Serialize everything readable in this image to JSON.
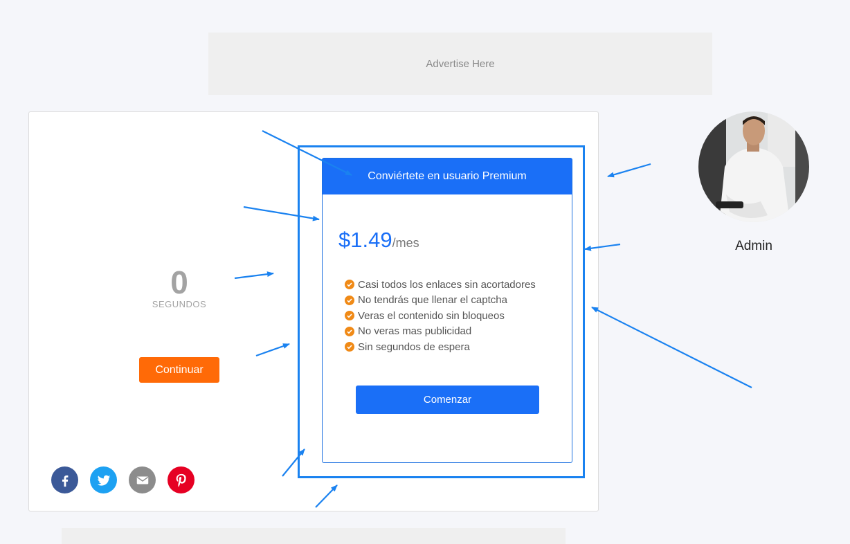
{
  "ad_top": {
    "text": "Advertise Here"
  },
  "countdown": {
    "value": "0",
    "label": "SEGUNDOS"
  },
  "continue_button": "Continuar",
  "share": {
    "icons": [
      "facebook-icon",
      "twitter-icon",
      "email-icon",
      "pinterest-icon"
    ],
    "colors": [
      "#3b5998",
      "#1da1f2",
      "#8c8c8c",
      "#e60023"
    ]
  },
  "premium": {
    "title": "Conviértete en usuario Premium",
    "price": "$1.49",
    "period": "/mes",
    "features": [
      "Casi todos los enlaces sin acortadores",
      "No tendrás que llenar el captcha",
      "Veras el contenido sin bloqueos",
      "No veras mas publicidad",
      "Sin segundos de espera"
    ],
    "button": "Comenzar"
  },
  "profile": {
    "name": "Admin"
  },
  "colors": {
    "accent": "#1a6ff7",
    "orange": "#ff6a07",
    "annotation": "#1a82f0"
  }
}
